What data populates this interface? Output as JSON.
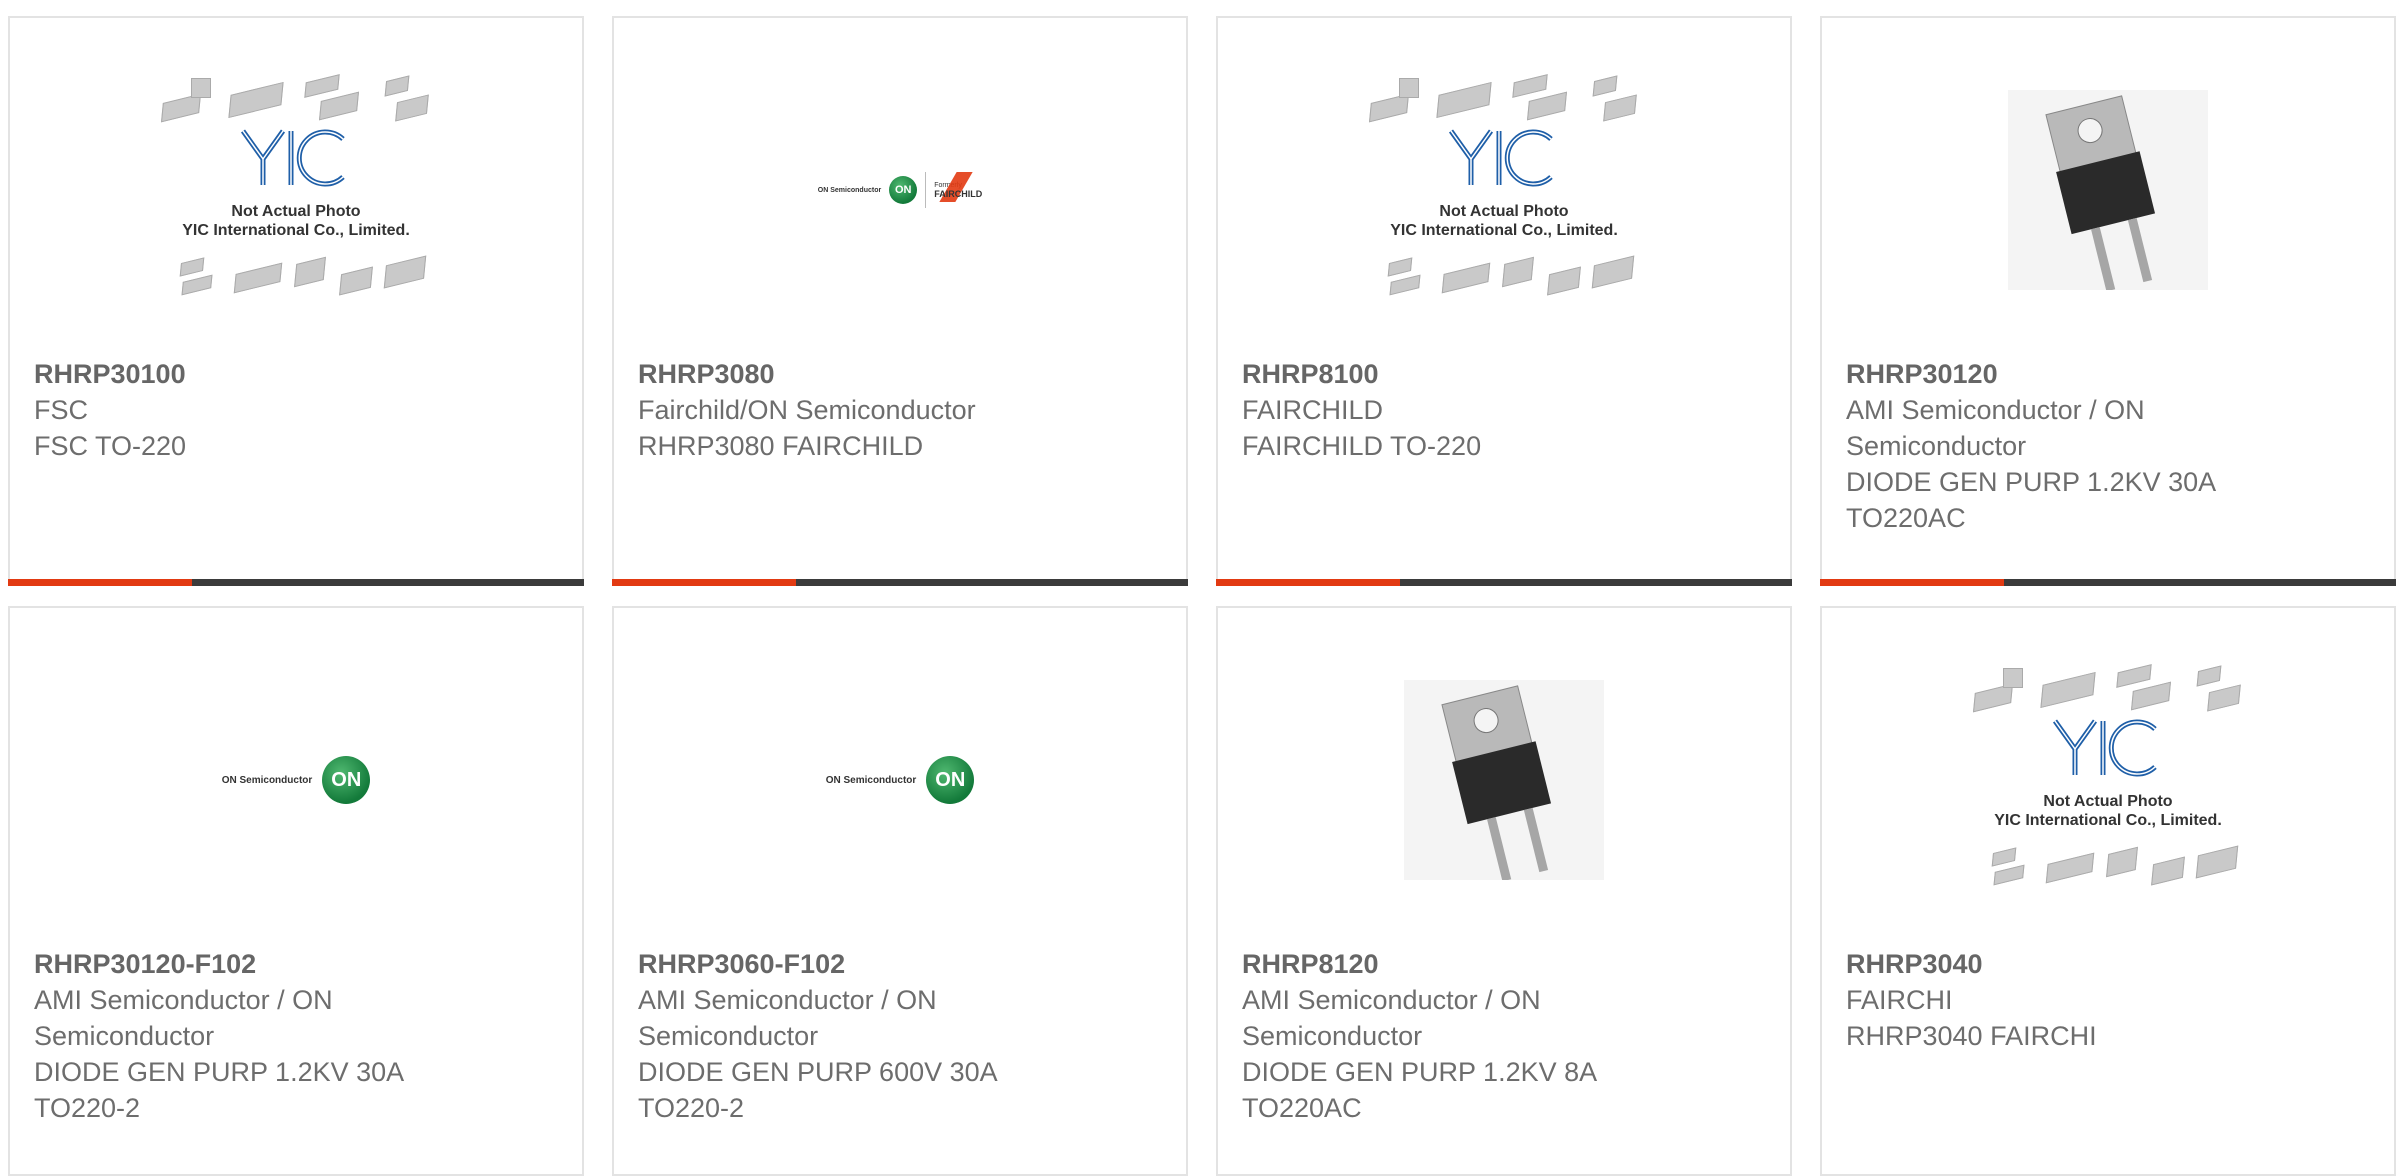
{
  "products": [
    {
      "title": "RHRP30100",
      "lines": [
        "FSC",
        "FSC TO-220"
      ],
      "image": "yic-not-actual-photo"
    },
    {
      "title": "RHRP3080",
      "lines": [
        "Fairchild/ON Semiconductor",
        "RHRP3080 FAIRCHILD"
      ],
      "image": "on-fairchild-logo"
    },
    {
      "title": "RHRP8100",
      "lines": [
        "FAIRCHILD",
        "FAIRCHILD TO-220"
      ],
      "image": "yic-not-actual-photo"
    },
    {
      "title": "RHRP30120",
      "lines": [
        "AMI Semiconductor / ON",
        "Semiconductor",
        "DIODE GEN PURP 1.2KV 30A",
        "TO220AC"
      ],
      "image": "to220-diode-photo"
    },
    {
      "title": "RHRP30120-F102",
      "lines": [
        "AMI Semiconductor / ON",
        "Semiconductor",
        "DIODE GEN PURP 1.2KV 30A",
        "TO220-2"
      ],
      "image": "on-semiconductor-logo"
    },
    {
      "title": "RHRP3060-F102",
      "lines": [
        "AMI Semiconductor / ON",
        "Semiconductor",
        "DIODE GEN PURP 600V 30A",
        "TO220-2"
      ],
      "image": "on-semiconductor-logo"
    },
    {
      "title": "RHRP8120",
      "lines": [
        "AMI Semiconductor / ON",
        "Semiconductor",
        "DIODE GEN PURP 1.2KV 8A",
        "TO220AC"
      ],
      "image": "to220-diode-photo"
    },
    {
      "title": "RHRP3040",
      "lines": [
        "FAIRCHI",
        "RHRP3040 FAIRCHI"
      ],
      "image": "yic-not-actual-photo"
    }
  ],
  "placeholder": {
    "line1": "Not Actual Photo",
    "line2": "YIC International Co., Limited."
  },
  "on_logo": {
    "text": "ON Semiconductor",
    "mark": "ON"
  },
  "fairchild_logo": {
    "formerly": "Formerly",
    "name": "FAIRCHILD"
  },
  "colors": {
    "accent": "#e23a12",
    "bar": "#3b3b3b"
  }
}
